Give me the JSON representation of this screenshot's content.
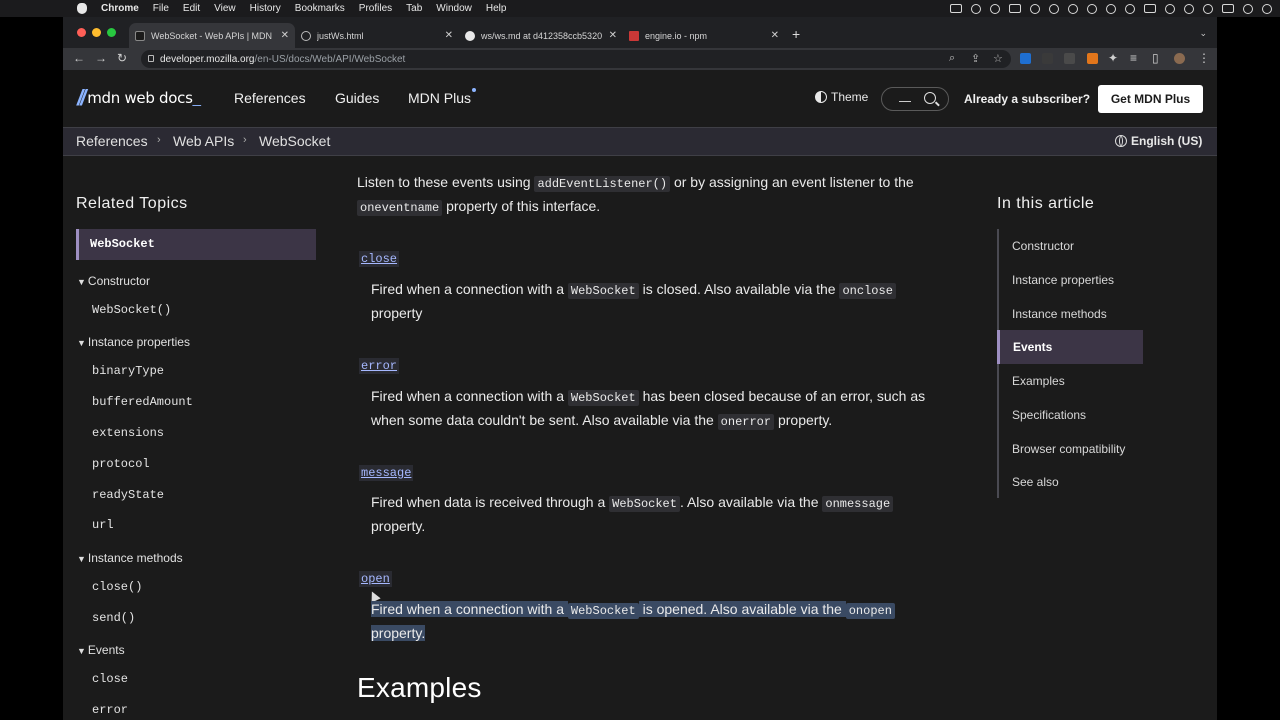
{
  "os_menubar": {
    "items": [
      "Chrome",
      "File",
      "Edit",
      "View",
      "History",
      "Bookmarks",
      "Profiles",
      "Tab",
      "Window",
      "Help"
    ]
  },
  "browser": {
    "tabs": [
      {
        "title": "WebSocket - Web APIs | MDN",
        "active": true
      },
      {
        "title": "justWs.html",
        "active": false
      },
      {
        "title": "ws/ws.md at d412358ccb5320",
        "active": false
      },
      {
        "title": "engine.io - npm",
        "active": false
      }
    ],
    "url_host": "developer.mozilla.org",
    "url_path": "/en-US/docs/Web/API/WebSocket"
  },
  "header": {
    "logo_text": "mdn web docs",
    "nav": [
      "References",
      "Guides",
      "MDN Plus"
    ],
    "theme_label": "Theme",
    "subscriber_label": "Already a subscriber?",
    "get_plus_label": "Get MDN Plus"
  },
  "breadcrumb": {
    "items": [
      "References",
      "Web APIs",
      "WebSocket"
    ],
    "language": "English (US)"
  },
  "sidebar": {
    "title": "Related Topics",
    "active": "WebSocket",
    "groups": [
      {
        "label": "Constructor",
        "items": [
          "WebSocket()"
        ]
      },
      {
        "label": "Instance properties",
        "items": [
          "binaryType",
          "bufferedAmount",
          "extensions",
          "protocol",
          "readyState",
          "url"
        ]
      },
      {
        "label": "Instance methods",
        "items": [
          "close()",
          "send()"
        ]
      },
      {
        "label": "Events",
        "items": [
          "close",
          "error"
        ]
      }
    ]
  },
  "content": {
    "intro": {
      "a": "Listen to these events using ",
      "code1": "addEventListener()",
      "b": " or by assigning an event listener to the",
      "code2": "oneventname",
      "c": " property of this interface."
    },
    "events": [
      {
        "name": "close",
        "l1a": "Fired when a connection with a ",
        "l1code": "WebSocket",
        "l1b": " is closed. Also available via the ",
        "l1code2": "onclose",
        "l2a": "property"
      },
      {
        "name": "error",
        "l1a": "Fired when a connection with a ",
        "l1code": "WebSocket",
        "l1b": " has been closed because of an error, such as",
        "l2a": "when some data couldn't be sent. Also available via the ",
        "l2code": "onerror",
        "l2b": " property."
      },
      {
        "name": "message",
        "l1a": "Fired when data is received through a ",
        "l1code": "WebSocket",
        "l1b": ". Also available via the ",
        "l1code2": "onmessage",
        "l2a": "property."
      },
      {
        "name": "open",
        "l1a": "Fired when a connection with a ",
        "l1code": "WebSocket",
        "l1b": " is opened. Also available via the ",
        "l1code2": "onopen",
        "l2a": "property."
      }
    ],
    "next_heading": "Examples"
  },
  "toc": {
    "title": "In this article",
    "items": [
      "Constructor",
      "Instance properties",
      "Instance methods",
      "Events",
      "Examples",
      "Specifications",
      "Browser compatibility",
      "See also"
    ],
    "active": "Events"
  }
}
